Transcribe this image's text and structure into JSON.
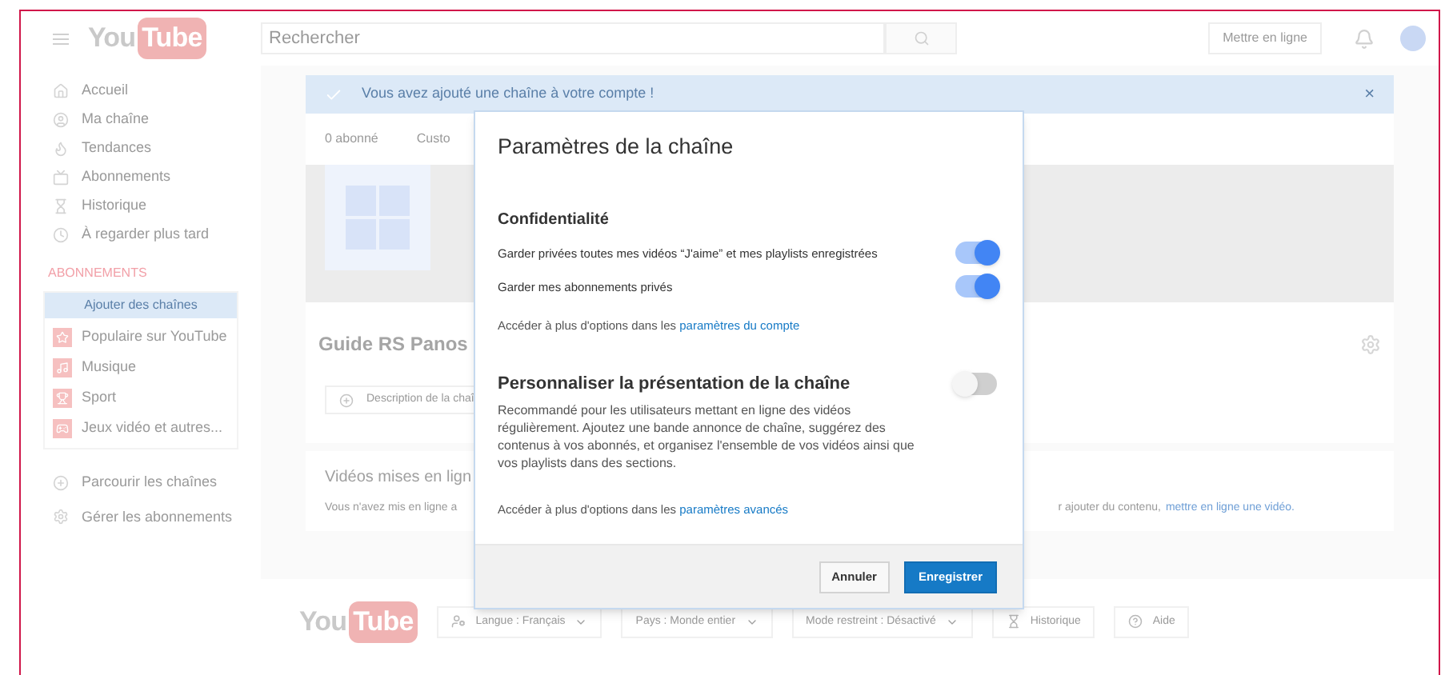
{
  "header": {
    "logo_you": "You",
    "logo_tube": "Tube",
    "search_placeholder": "Rechercher",
    "upload_button": "Mettre en ligne"
  },
  "sidebar": {
    "items": [
      "Accueil",
      "Ma chaîne",
      "Tendances",
      "Abonnements",
      "Historique",
      "À regarder plus tard"
    ],
    "section_title": "ABONNEMENTS",
    "add_button": "Ajouter des chaînes",
    "channels": [
      "Populaire sur YouTube",
      "Musique",
      "Sport",
      "Jeux vidéo et autres..."
    ],
    "bottom_items": [
      "Parcourir les chaînes",
      "Gérer les abonnements"
    ]
  },
  "banner": {
    "message": "Vous avez ajouté une chaîne à votre compte !",
    "close": "×"
  },
  "channel": {
    "subscribers": "0 abonné",
    "customize": "Custo",
    "name": "Guide RS Panos",
    "description_button": "Description de la chaî"
  },
  "uploads": {
    "title": "Vidéos mises en lign",
    "text_start": "Vous n'avez mis en ligne a",
    "text_end": "r ajouter du contenu,",
    "link": "mettre en ligne une vidéo."
  },
  "footer": {
    "logo_you": "You",
    "logo_tube": "Tube",
    "buttons": [
      {
        "label": "Langue : Français",
        "dropdown": true
      },
      {
        "label": "Pays : Monde entier",
        "dropdown": true
      },
      {
        "label": "Mode restreint : Désactivé",
        "dropdown": true
      },
      {
        "label": "Historique",
        "dropdown": false
      },
      {
        "label": "Aide",
        "dropdown": false
      }
    ]
  },
  "dialog": {
    "title": "Paramètres de la chaîne",
    "sections": [
      {
        "title": "Confidentialité",
        "toggles": [
          {
            "label": "Garder privées toutes mes vidéos “J'aime” et mes playlists enregistrées",
            "on": true
          },
          {
            "label": "Garder mes abonnements privés",
            "on": true
          }
        ],
        "more_text": "Accéder à plus d'options dans les",
        "more_link": "paramètres du compte"
      },
      {
        "title": "Personnaliser la présentation de la chaîne",
        "on": false,
        "description": "Recommandé pour les utilisateurs mettant en ligne des vidéos régulièrement. Ajoutez une bande annonce de chaîne, suggérez des contenus à vos abonnés, et organisez l'ensemble de vos vidéos ainsi que vos playlists dans des sections.",
        "more_text": "Accéder à plus d'options dans les",
        "more_link": "paramètres avancés"
      }
    ],
    "cancel_button": "Annuler",
    "save_button": "Enregistrer"
  }
}
